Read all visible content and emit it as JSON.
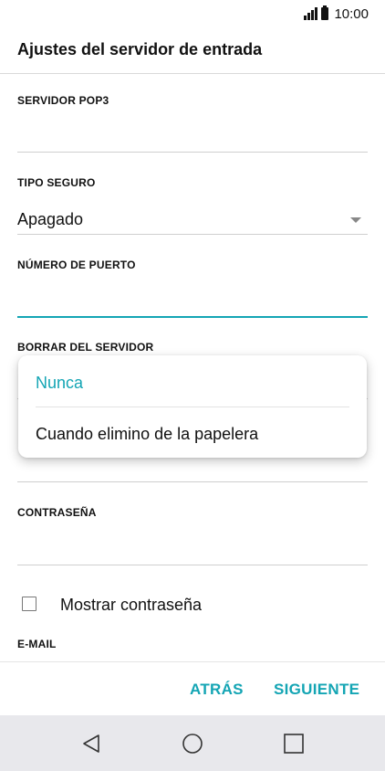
{
  "status_bar": {
    "time": "10:00"
  },
  "app_bar": {
    "title": "Ajustes del servidor de entrada"
  },
  "fields": {
    "pop3_server": {
      "label": "SERVIDOR POP3",
      "value": ""
    },
    "secure_type": {
      "label": "TIPO SEGURO",
      "value": "Apagado"
    },
    "port_number": {
      "label": "NÚMERO DE PUERTO",
      "value": ""
    },
    "delete_from_server": {
      "label": "BORRAR DEL SERVIDOR"
    },
    "password": {
      "label": "CONTRASEÑA",
      "value": ""
    },
    "email": {
      "label": "E-MAIL"
    }
  },
  "popup": {
    "options": [
      {
        "label": "Nunca",
        "selected": true
      },
      {
        "label": "Cuando elimino de la papelera",
        "selected": false
      }
    ]
  },
  "show_password": {
    "label": "Mostrar contraseña",
    "checked": false
  },
  "actions": {
    "back": "ATRÁS",
    "next": "SIGUIENTE"
  },
  "colors": {
    "accent": "#14a5b4",
    "nav_bg": "#e8e8ec"
  },
  "icons": {
    "nav_back": "back-triangle-icon",
    "nav_home": "home-circle-icon",
    "nav_recents": "recents-square-icon"
  }
}
